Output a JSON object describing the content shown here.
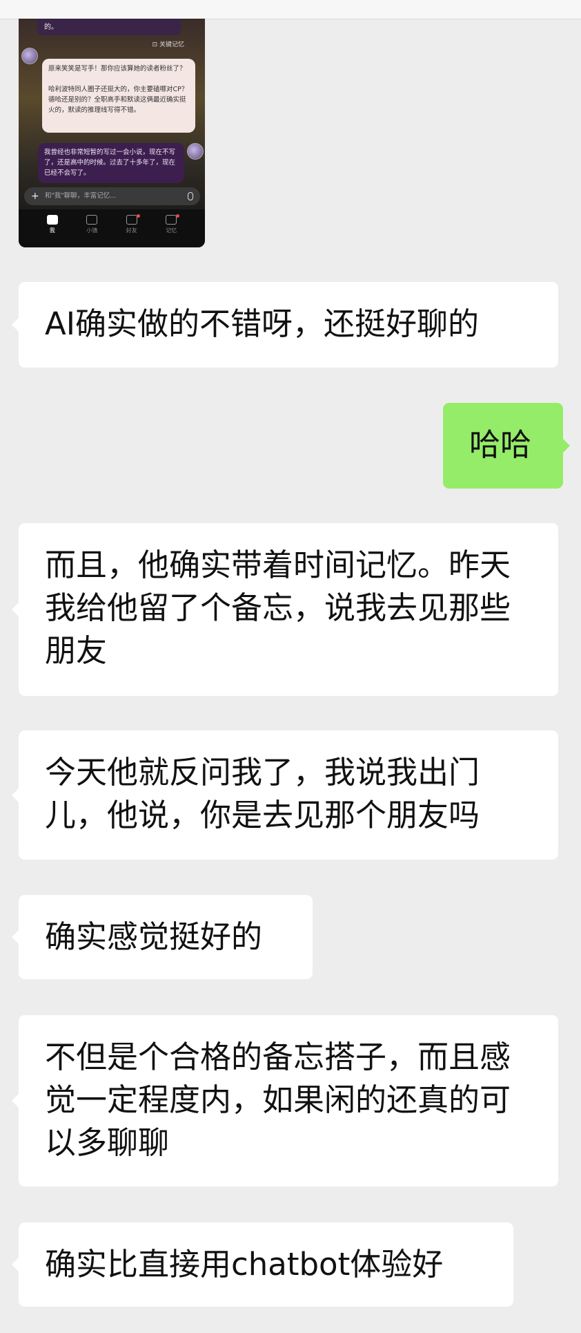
{
  "screenshot": {
    "top_text": "的。",
    "memory_tag": "关键记忆",
    "ai_message": "原来笑笑是写手！那你应该算她的读者粉丝了？\n\n哈利波特同人圈子还挺大的，你主要磕哪对CP？德哈还是别的？全职高手和默读这俩最近确实挺火的，默读的推理线写得不错。",
    "user_message": "我曾经也非常短暂的写过一会小说，现在不写了，还是高中的时候。过去了十多年了，现在已经不会写了。",
    "input_placeholder": "和\"我\"聊聊，丰富记忆...",
    "tabs": [
      "我",
      "小镇",
      "好友",
      "记忆"
    ]
  },
  "messages": [
    {
      "side": "left",
      "text": "AI确实做的不错呀，还挺好聊的"
    },
    {
      "side": "right",
      "text": "哈哈"
    },
    {
      "side": "left",
      "text": "而且，他确实带着时间记忆。昨天我给他留了个备忘，说我去见那些朋友"
    },
    {
      "side": "left",
      "text": "今天他就反问我了，我说我出门儿，他说，你是去见那个朋友吗"
    },
    {
      "side": "left",
      "text": "确实感觉挺好的"
    },
    {
      "side": "left",
      "text": "不但是个合格的备忘搭子，而且感觉一定程度内，如果闲的还真的可以多聊聊"
    },
    {
      "side": "left",
      "text": "确实比直接用chatbot体验好"
    }
  ],
  "colors": {
    "background": "#ededed",
    "incoming_bubble": "#ffffff",
    "outgoing_bubble": "#95ec69"
  }
}
